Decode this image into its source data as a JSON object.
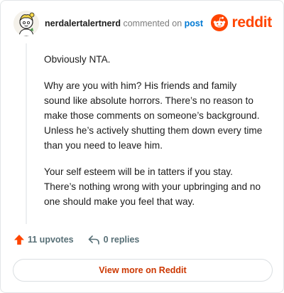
{
  "header": {
    "username": "nerdalertalertnerd",
    "action": "commented on",
    "target_link": "post",
    "brand": "reddit",
    "avatar_icon": "avatar-icon",
    "brand_color": "#ff4500"
  },
  "comment": {
    "paragraphs": [
      "Obviously NTA.",
      "Why are you with him? His friends and family sound like absolute horrors. There’s no reason to make those comments on someone’s background. Unless he’s actively shutting them down every time than you need to leave him.",
      "Your self esteem will be in tatters if you stay. There’s nothing wrong with your upbringing and no one should make you feel that way."
    ]
  },
  "footer": {
    "upvotes": "11 upvotes",
    "replies": "0 replies",
    "upvote_icon": "upvote-arrow-icon",
    "reply_icon": "reply-arrow-icon",
    "upvote_color": "#ff4500"
  },
  "cta": {
    "label": "View more on Reddit"
  }
}
